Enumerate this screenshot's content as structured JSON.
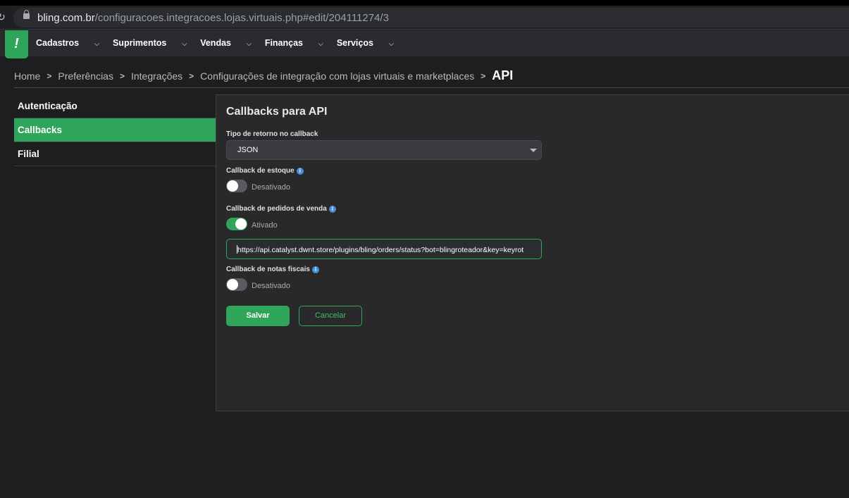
{
  "browser": {
    "url_host": "bling.com.br",
    "url_path": "/configuracoes.integracoes.lojas.virtuais.php#edit/204111274/3"
  },
  "nav": {
    "logo": "!",
    "items": [
      {
        "label": "Cadastros"
      },
      {
        "label": "Suprimentos"
      },
      {
        "label": "Vendas"
      },
      {
        "label": "Finanças"
      },
      {
        "label": "Serviços"
      }
    ]
  },
  "breadcrumb": [
    "Home",
    "Preferências",
    "Integrações",
    "Configurações de integração com lojas virtuais e marketplaces",
    "API"
  ],
  "sidebar": {
    "items": [
      {
        "label": "Autenticação"
      },
      {
        "label": "Callbacks",
        "active": true
      },
      {
        "label": "Filial"
      }
    ]
  },
  "form": {
    "title": "Callbacks para API",
    "return_type_label": "Tipo de retorno no callback",
    "return_type_value": "JSON",
    "stock_label": "Callback de estoque",
    "stock_state": "Desativado",
    "stock_on": false,
    "orders_label": "Callback de pedidos de venda",
    "orders_state": "Ativado",
    "orders_on": true,
    "orders_url": "https://api.catalyst.dwnt.store/plugins/bling/orders/status?bot=blingroteador&key=keyrot",
    "invoices_label": "Callback de notas fiscais",
    "invoices_state": "Desativado",
    "invoices_on": false,
    "info_icon": "i",
    "save_label": "Salvar",
    "cancel_label": "Cancelar"
  },
  "colors": {
    "accent": "#2fa55a",
    "info": "#4a8fd6"
  }
}
